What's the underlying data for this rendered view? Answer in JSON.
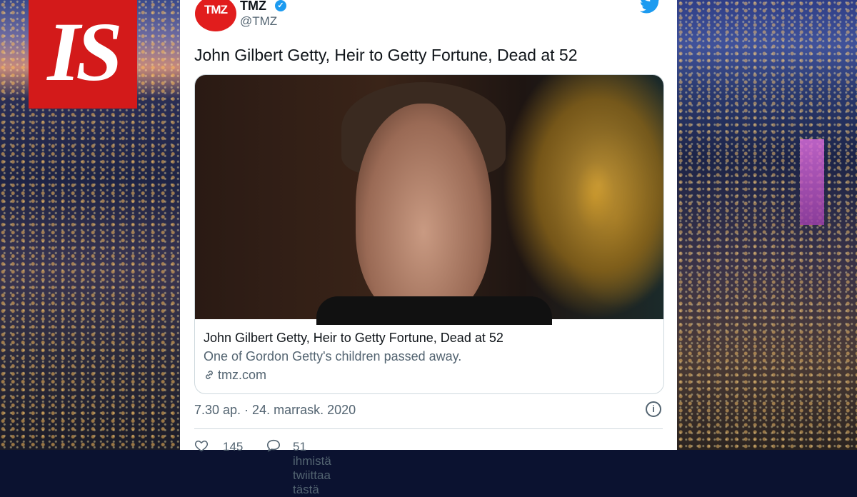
{
  "logo": {
    "text": "IS"
  },
  "tweet": {
    "avatar_text": "TMZ",
    "name": "TMZ",
    "verified": "✓",
    "handle": "@TMZ",
    "text": "John Gilbert Getty, Heir to Getty Fortune, Dead at 52",
    "link_card": {
      "title": "John Gilbert Getty, Heir to Getty Fortune, Dead at 52",
      "description": "One of Gordon Getty's children passed away.",
      "domain": "tmz.com"
    },
    "timestamp": "7.30 ap. · 24. marrask. 2020",
    "likes": "145",
    "retweets_text": "51 ihmistä twiittaa tästä"
  },
  "colors": {
    "accent": "#1d9bf0",
    "logo_red": "#d31a1a",
    "tmz_red": "#e11d1d"
  },
  "icons": [
    "twitter-bird-icon",
    "verified-icon",
    "link-icon",
    "info-icon",
    "heart-icon",
    "comment-icon"
  ]
}
